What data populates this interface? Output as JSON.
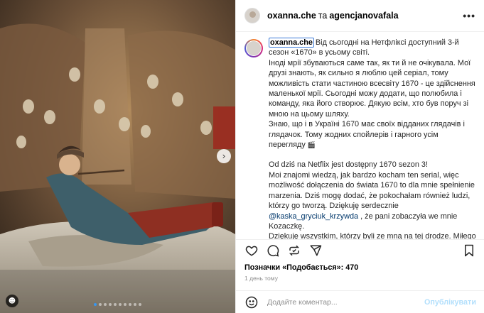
{
  "header": {
    "user1": "oxanna.che",
    "conjunction": "та",
    "user2": "agencjanovafala",
    "more_icon": "more-horizontal-icon"
  },
  "caption": {
    "owner": "oxanna.che",
    "lines": [
      "Від сьогодні на Нетфліксі доступний 3-й сезон «1670» в усьому світі.",
      "Іноді мрії збуваються саме так, як ти й не очікувала. Мої друзі знають, як сильно я люблю цей серіал, тому можливість стати частиною всесвіту 1670 - це здійснення маленької мрії. Сьогодні можу додати, що полюбила і команду, яка його створює. Дякую всім, хто був поруч зі мною на цьому шляху.",
      "Знаю, що і в Україні 1670 має своїх відданих глядачів і глядачок. Тому жодних спойлерів і гарного усім перегляду"
    ],
    "pl_lines": [
      "Od dziś na Netflix jest dostępny 1670 sezon 3!",
      "Moi znajomi wiedzą, jak bardzo kocham ten serial, więc możliwość dołączenia do świata 1670 to dla mnie spełnienie marzenia. Dziś mogę dodać, że pokochałam również ludzi, którzy go tworzą. Dziękuję serdecznie"
    ],
    "mention": "@kaska_gryciuk_krzywda",
    "pl_after_mention": ", że pani zobaczyła we mnie Kozaczkę.",
    "pl_last": "Dziękuję wszystkim, którzy byli ze mną na tej drodze. Miłego oglądania!",
    "clapper_icon": "clapper-board-icon"
  },
  "actions": {
    "like_icon": "heart-icon",
    "comment_icon": "comment-icon",
    "share_icon": "repost-icon",
    "send_icon": "send-icon",
    "save_icon": "bookmark-icon"
  },
  "likes": "Позначки «Подобається»: 470",
  "time": "1 день тому",
  "comment": {
    "placeholder": "Додайте коментар...",
    "publish_label": "Опублікувати",
    "emoji_icon": "emoji-icon"
  },
  "carousel": {
    "total": 10,
    "current": 1
  },
  "colors": {
    "link_blue": "#00376b",
    "publish_disabled": "#b2dffc",
    "active_dot": "#3897f0"
  }
}
